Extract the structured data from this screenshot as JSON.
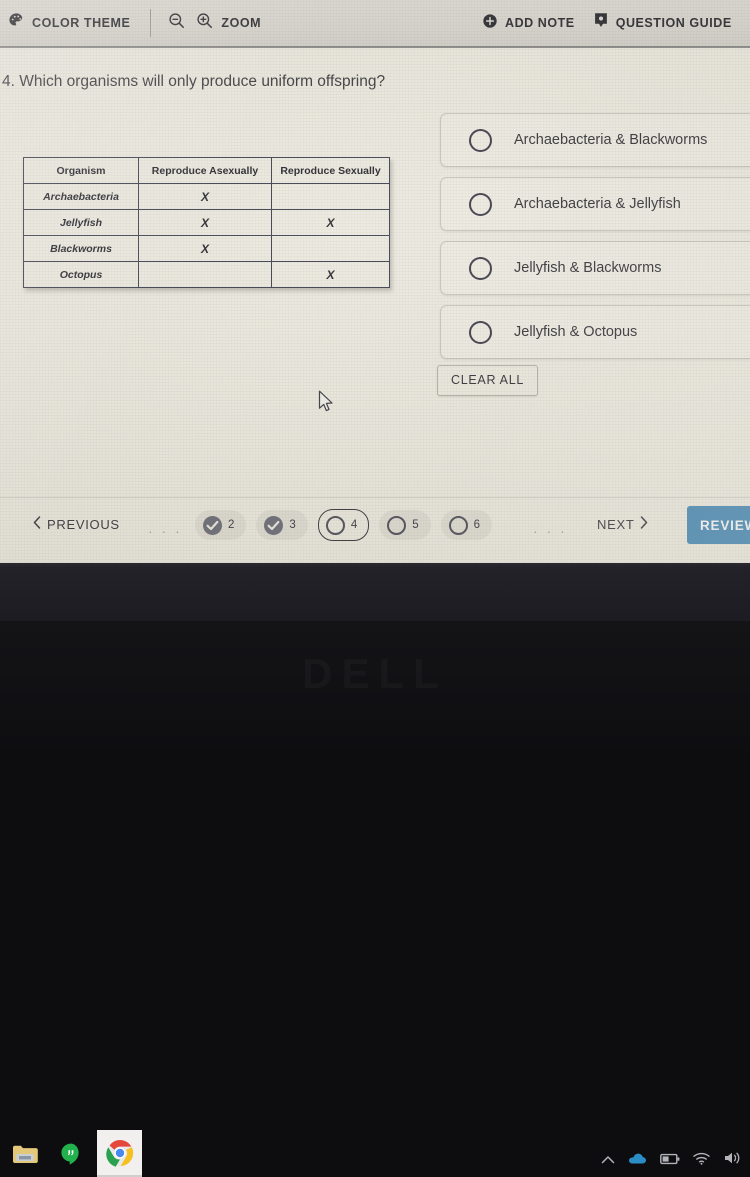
{
  "toolbar": {
    "color_theme": {
      "label": "COLOR THEME",
      "icon": "palette-icon"
    },
    "zoom": {
      "label": "ZOOM",
      "out_icon": "zoom-out-icon",
      "in_icon": "zoom-in-icon"
    },
    "add_note": {
      "label": "ADD NOTE",
      "icon": "add-note-icon"
    },
    "question_guide": {
      "label": "QUESTION GUIDE",
      "icon": "question-guide-icon"
    }
  },
  "question": {
    "number": "4.",
    "text": "Which organisms will only produce uniform offspring?"
  },
  "table": {
    "headers": [
      "Organism",
      "Reproduce Asexually",
      "Reproduce Sexually"
    ],
    "rows": [
      {
        "organism": "Archaebacteria",
        "asexual": "X",
        "sexual": ""
      },
      {
        "organism": "Jellyfish",
        "asexual": "X",
        "sexual": "X"
      },
      {
        "organism": "Blackworms",
        "asexual": "X",
        "sexual": ""
      },
      {
        "organism": "Octopus",
        "asexual": "",
        "sexual": "X"
      }
    ]
  },
  "options": [
    {
      "label": "Archaebacteria & Blackworms",
      "selected": false
    },
    {
      "label": "Archaebacteria & Jellyfish",
      "selected": false
    },
    {
      "label": "Jellyfish & Blackworms",
      "selected": false
    },
    {
      "label": "Jellyfish & Octopus",
      "selected": false
    }
  ],
  "clear_all_label": "CLEAR ALL",
  "nav": {
    "previous_label": "PREVIOUS",
    "next_label": "NEXT",
    "review_label": "REVIEW",
    "ellipsis_left": "· · ·",
    "ellipsis_right": "· · ·",
    "pages": [
      {
        "number": "2",
        "state": "done"
      },
      {
        "number": "3",
        "state": "done"
      },
      {
        "number": "4",
        "state": "current"
      },
      {
        "number": "5",
        "state": "open"
      },
      {
        "number": "6",
        "state": "open"
      }
    ]
  },
  "taskbar": {
    "items": [
      {
        "name": "file-explorer-icon"
      },
      {
        "name": "hangouts-icon"
      },
      {
        "name": "chrome-icon"
      }
    ],
    "tray": [
      {
        "name": "chevron-up-icon"
      },
      {
        "name": "onedrive-cloud-icon"
      },
      {
        "name": "battery-icon"
      },
      {
        "name": "wifi-icon"
      },
      {
        "name": "volume-icon"
      }
    ]
  },
  "bezel": {
    "brand": "DELL"
  },
  "colors": {
    "accent_blue": "#4a8ab5",
    "screen_bg": "#ece9df",
    "toolbar_bg": "#d9d6cf",
    "text": "#34343a"
  }
}
